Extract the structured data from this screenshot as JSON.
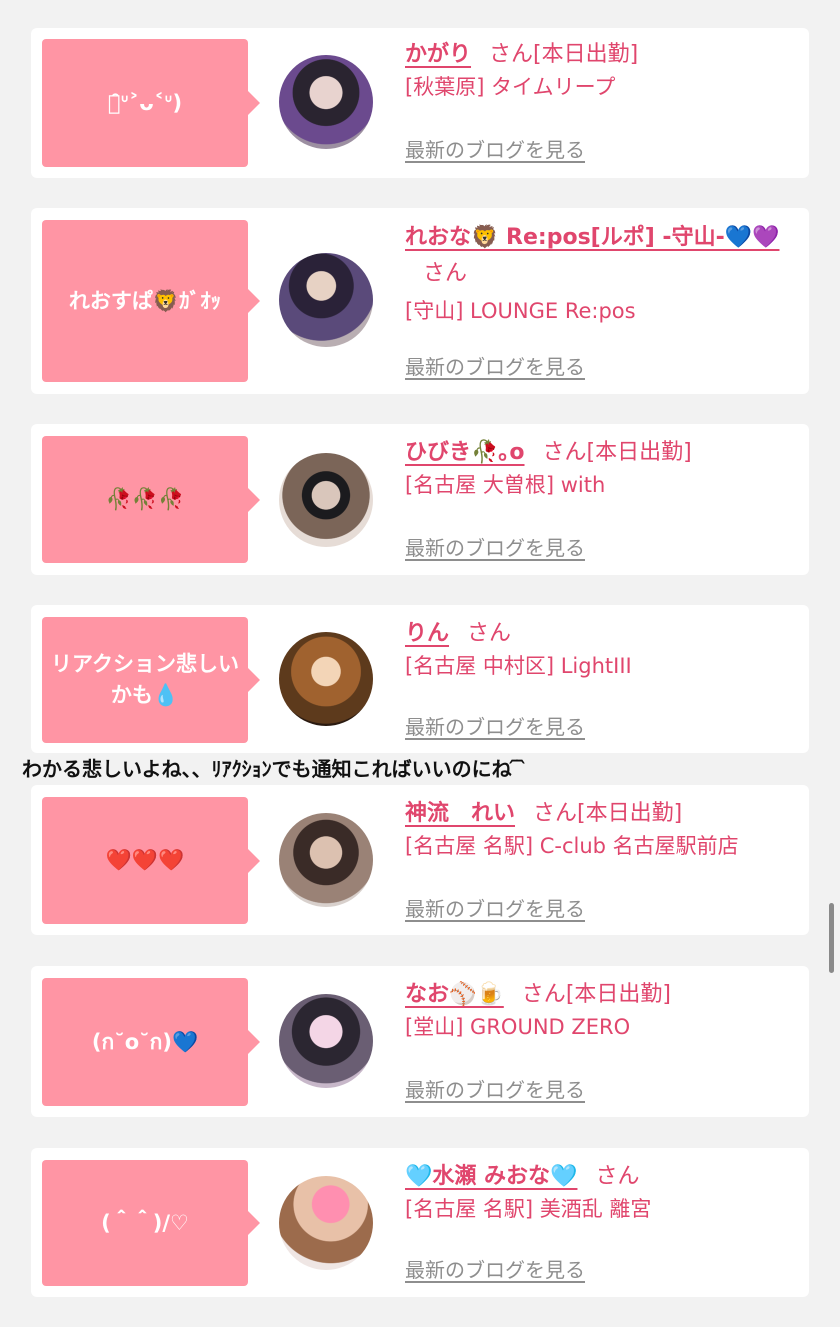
{
  "blog_link_label": "最新のブログを見る",
  "honorific": "さん",
  "colors": {
    "accent": "#e0466d",
    "bubble": "#ff95a4",
    "muted": "#8e8e8e"
  },
  "cards": [
    {
      "bubble": "ﾛ̑ᐡ˃ᴗ˂ᐡ)",
      "name": "かがり",
      "status": "[本日出勤]",
      "shop": "[秋葉原] タイムリープ"
    },
    {
      "bubble": "れおすぱ🦁ｶﾞｵｯ",
      "name": "れおな🦁 Re:pos[ルポ] -守山-💙💜",
      "status": "",
      "shop": "[守山] LOUNGE Re:pos"
    },
    {
      "bubble": "🥀🥀🥀",
      "name": "ひびき🥀｡o",
      "status": "[本日出勤]",
      "shop": "[名古屋 大曽根] with"
    },
    {
      "bubble": "リアクション悲しいかも💧",
      "name": "りん",
      "status": "",
      "shop": "[名古屋 中村区] LightIII"
    },
    {
      "bubble": "❤️❤️❤️",
      "name": "神流　れい",
      "status": "[本日出勤]",
      "shop": "[名古屋 名駅] C-club 名古屋駅前店"
    },
    {
      "bubble": "(ก˘o˘ก)💙",
      "name": "なお⚾️🍺",
      "status": "[本日出勤]",
      "shop": "[堂山] GROUND ZERO"
    },
    {
      "bubble": "(＾＾)/♡",
      "name": "🩵水瀬 みおな🩵",
      "status": "",
      "shop": "[名古屋 名駅] 美酒乱 離宮"
    }
  ],
  "overlay_comment": "わかる悲しいよね、、ﾘｱｸｼｮﾝでも通知こればいいのにね ᷇ ᷆"
}
